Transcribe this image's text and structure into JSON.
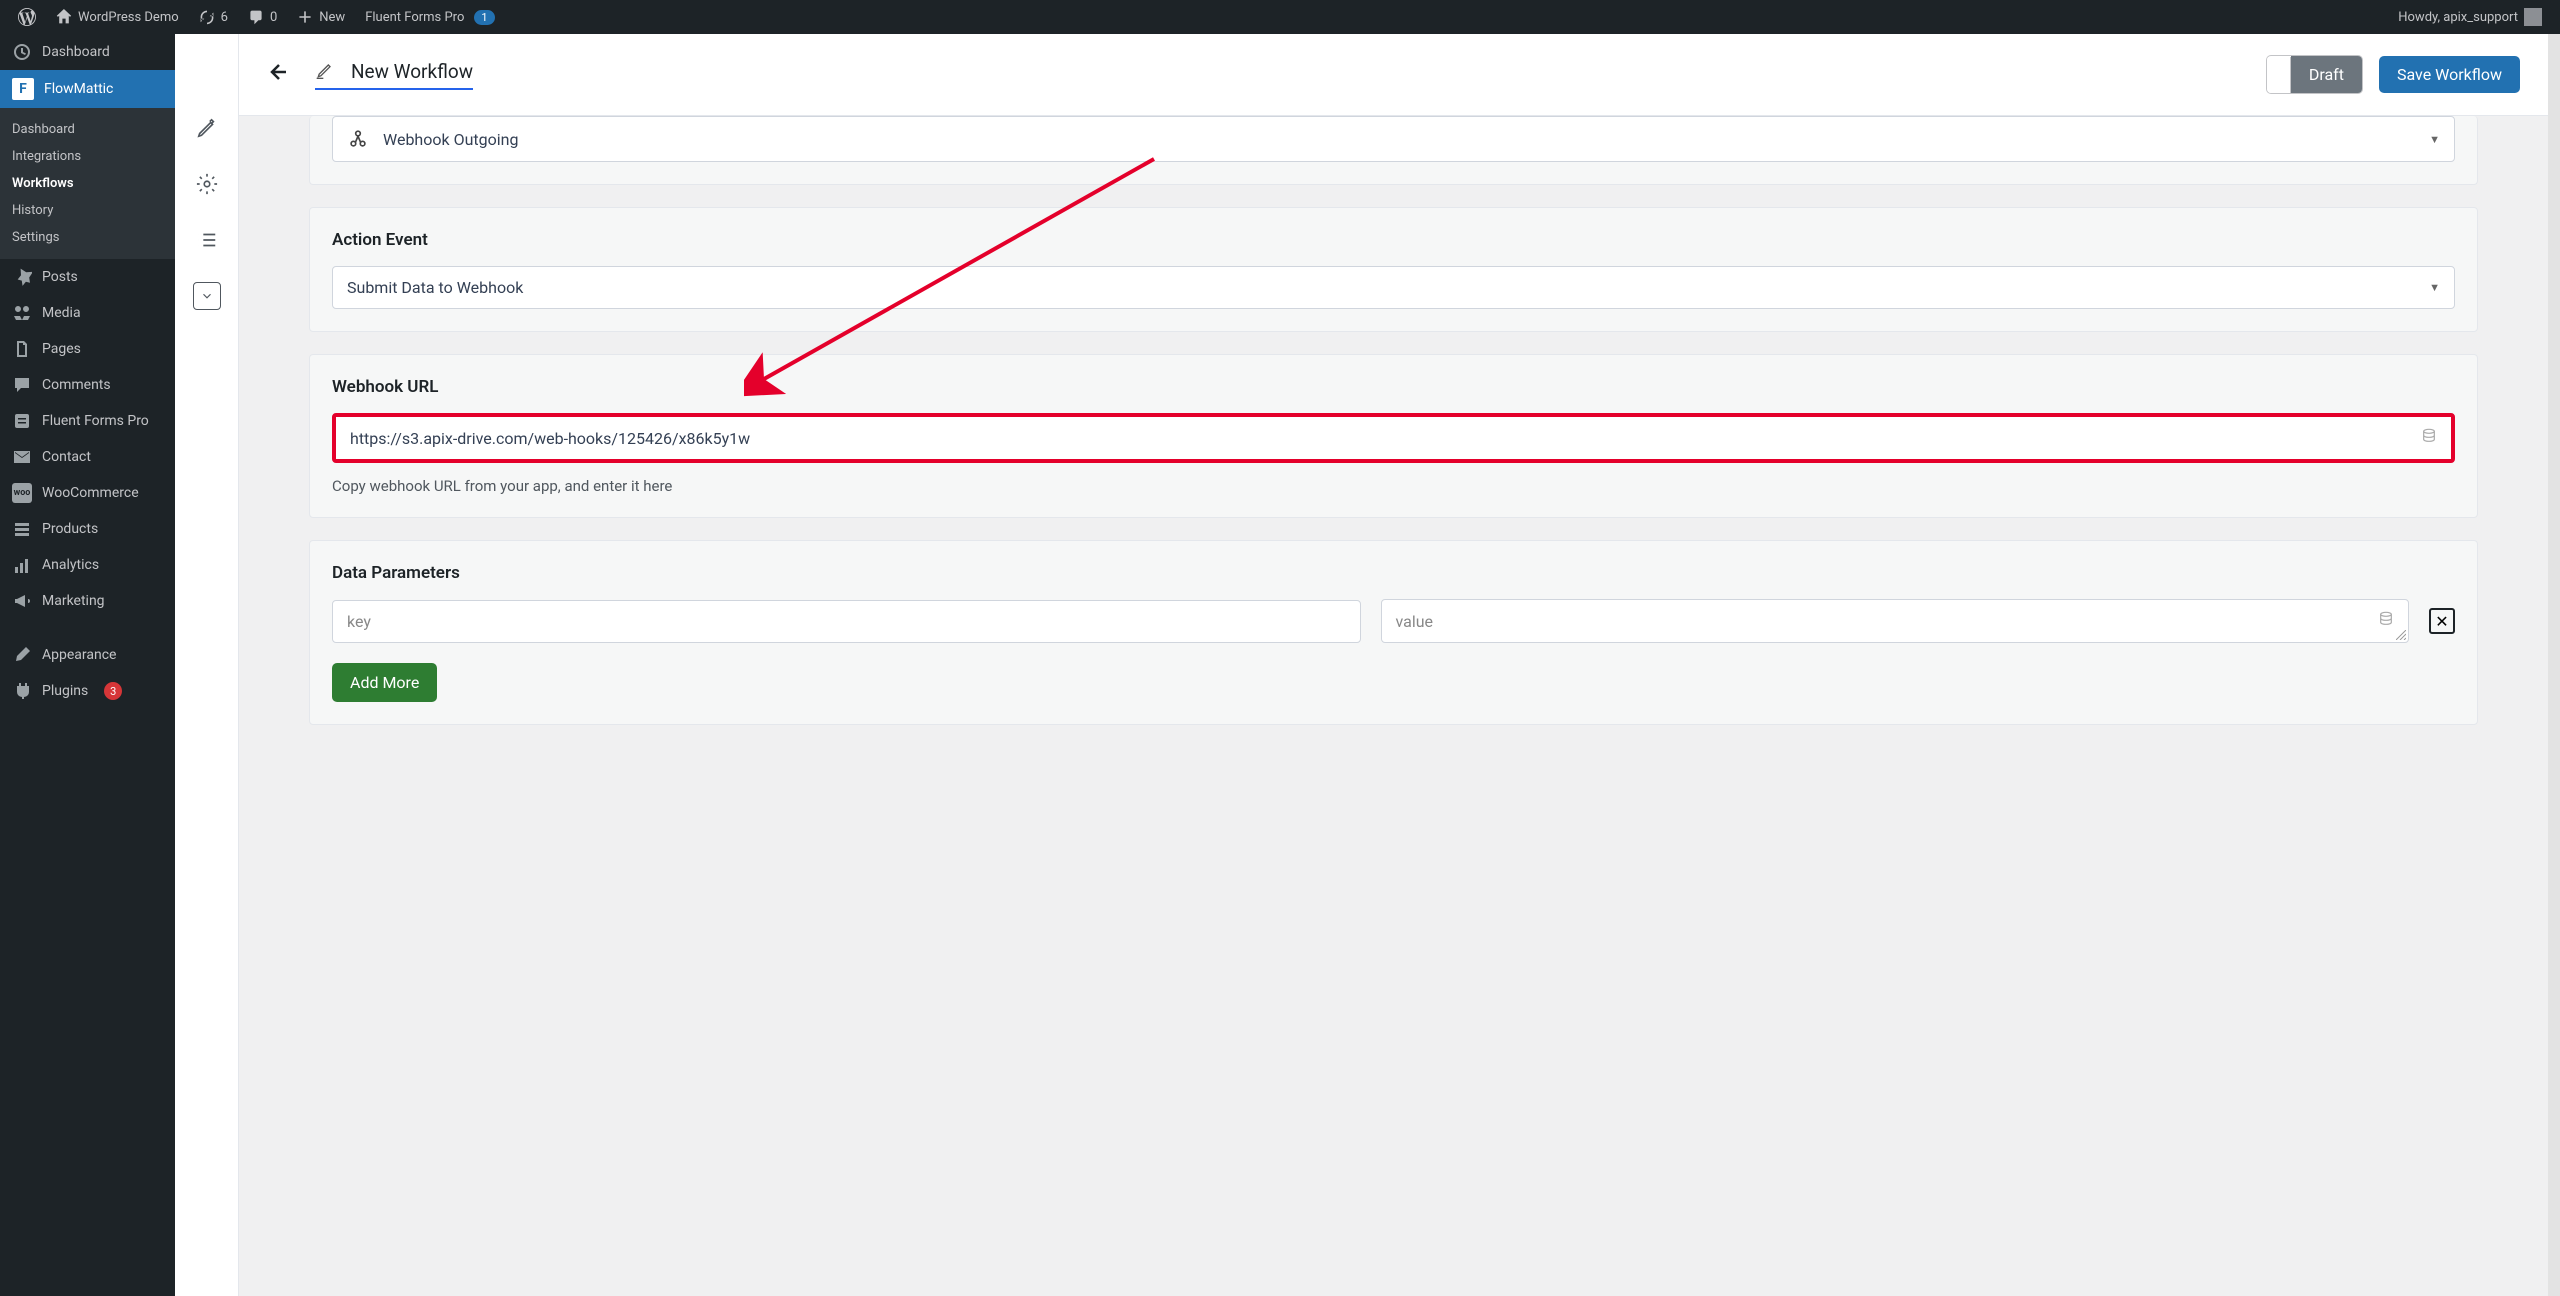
{
  "adminbar": {
    "site_name": "WordPress Demo",
    "updates_count": "6",
    "comments_count": "0",
    "new_label": "New",
    "fluent_forms_label": "Fluent Forms Pro",
    "fluent_forms_badge": "1",
    "howdy": "Howdy, apix_support"
  },
  "sidebar": {
    "items": [
      {
        "label": "Dashboard"
      },
      {
        "label": "FlowMattic"
      },
      {
        "label": "Posts"
      },
      {
        "label": "Media"
      },
      {
        "label": "Pages"
      },
      {
        "label": "Comments"
      },
      {
        "label": "Fluent Forms Pro"
      },
      {
        "label": "Contact"
      },
      {
        "label": "WooCommerce"
      },
      {
        "label": "Products"
      },
      {
        "label": "Analytics"
      },
      {
        "label": "Marketing"
      },
      {
        "label": "Appearance"
      },
      {
        "label": "Plugins"
      }
    ],
    "submenu": [
      {
        "label": "Dashboard"
      },
      {
        "label": "Integrations"
      },
      {
        "label": "Workflows"
      },
      {
        "label": "History"
      },
      {
        "label": "Settings"
      }
    ],
    "plugins_badge": "3"
  },
  "topbar": {
    "title": "New Workflow",
    "draft_label": "Draft",
    "save_label": "Save Workflow"
  },
  "form": {
    "app_selected": "Webhook Outgoing",
    "action_event_label": "Action Event",
    "action_event_selected": "Submit Data to Webhook",
    "webhook_url_label": "Webhook URL",
    "webhook_url_value": "https://s3.apix-drive.com/web-hooks/125426/x86k5y1w",
    "webhook_help": "Copy webhook URL from your app, and enter it here",
    "data_params_label": "Data Parameters",
    "key_placeholder": "key",
    "value_placeholder": "value",
    "add_more_label": "Add More"
  }
}
